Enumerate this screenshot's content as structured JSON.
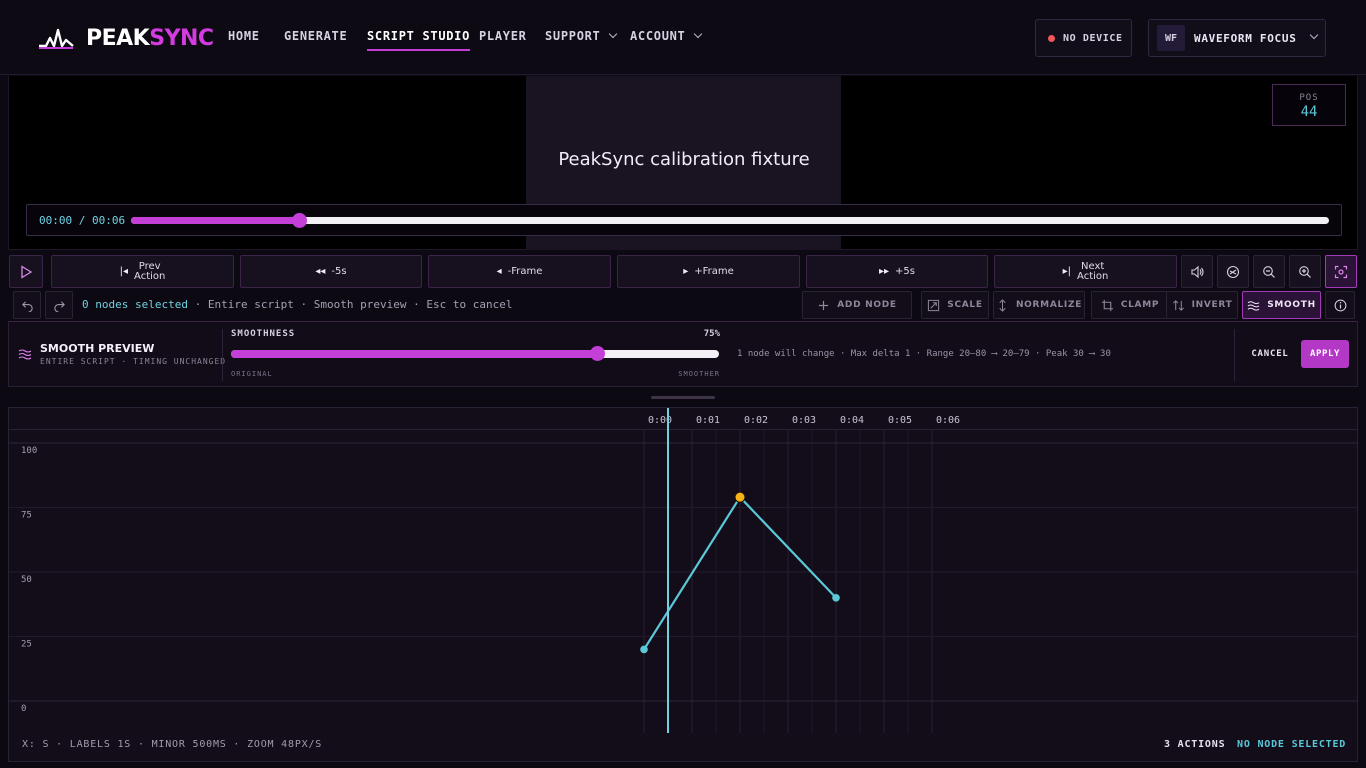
{
  "brand": {
    "peak": "PEAK",
    "sync": "SYNC"
  },
  "nav": {
    "items": [
      {
        "label": "HOME"
      },
      {
        "label": "GENERATE"
      },
      {
        "label": "SCRIPT STUDIO",
        "active": true
      },
      {
        "label": "PLAYER"
      },
      {
        "label": "SUPPORT",
        "dropdown": true
      },
      {
        "label": "ACCOUNT",
        "dropdown": true
      }
    ],
    "device_status": "NO DEVICE",
    "account_initials": "WF",
    "account_name": "WAVEFORM FOCUS"
  },
  "video": {
    "title": "PeakSync calibration fixture",
    "pos_label": "POS",
    "pos_value": "44",
    "time_display": "00:00 / 00:06",
    "progress": 0.14
  },
  "transport": {
    "prev_action": [
      "Prev",
      "Action"
    ],
    "back5": "-5s",
    "prev_frame": "-Frame",
    "next_frame": "+Frame",
    "fwd5": "+5s",
    "next_action": [
      "Next",
      "Action"
    ]
  },
  "toolbar": {
    "selection": "0 nodes selected",
    "status_rest": " · Entire script · Smooth preview · Esc to cancel",
    "add_node": "ADD NODE",
    "scale": "SCALE",
    "normalize": "NORMALIZE",
    "clamp": "CLAMP",
    "invert": "INVERT",
    "smooth": "SMOOTH"
  },
  "smooth_panel": {
    "title": "SMOOTH PREVIEW",
    "subtitle": "ENTIRE SCRIPT · TIMING UNCHANGED",
    "slider_label": "SMOOTHNESS",
    "value_text": "75%",
    "value": 0.75,
    "min_label": "ORIGINAL",
    "max_label": "SMOOTHER",
    "summary": "1 node will change · Max delta 1 · Range 20–80 ⟶ 20–79 · Peak 30 ⟶ 30",
    "cancel": "CANCEL",
    "apply": "APPLY"
  },
  "timeline": {
    "time_labels": [
      "0:00",
      "0:01",
      "0:02",
      "0:03",
      "0:04",
      "0:05",
      "0:06"
    ],
    "y_labels": [
      "100",
      "75",
      "50",
      "25",
      "0"
    ],
    "playhead_s": 0.5,
    "footer_left": "X: S · LABELS 1S · MINOR 500MS · ZOOM 48PX/S",
    "action_count": "3 ACTIONS",
    "selection_status": "NO NODE SELECTED"
  },
  "chart_data": {
    "type": "line",
    "x": [
      0,
      2,
      4
    ],
    "y": [
      20,
      79,
      40
    ],
    "xlabel": "",
    "ylabel": "",
    "ylim": [
      0,
      100
    ],
    "xlim": [
      0,
      6
    ],
    "highlight_index": 1,
    "colors": {
      "line": "#5bc8d8",
      "highlight": "#f5b316",
      "accent": "#c43ed8"
    }
  }
}
